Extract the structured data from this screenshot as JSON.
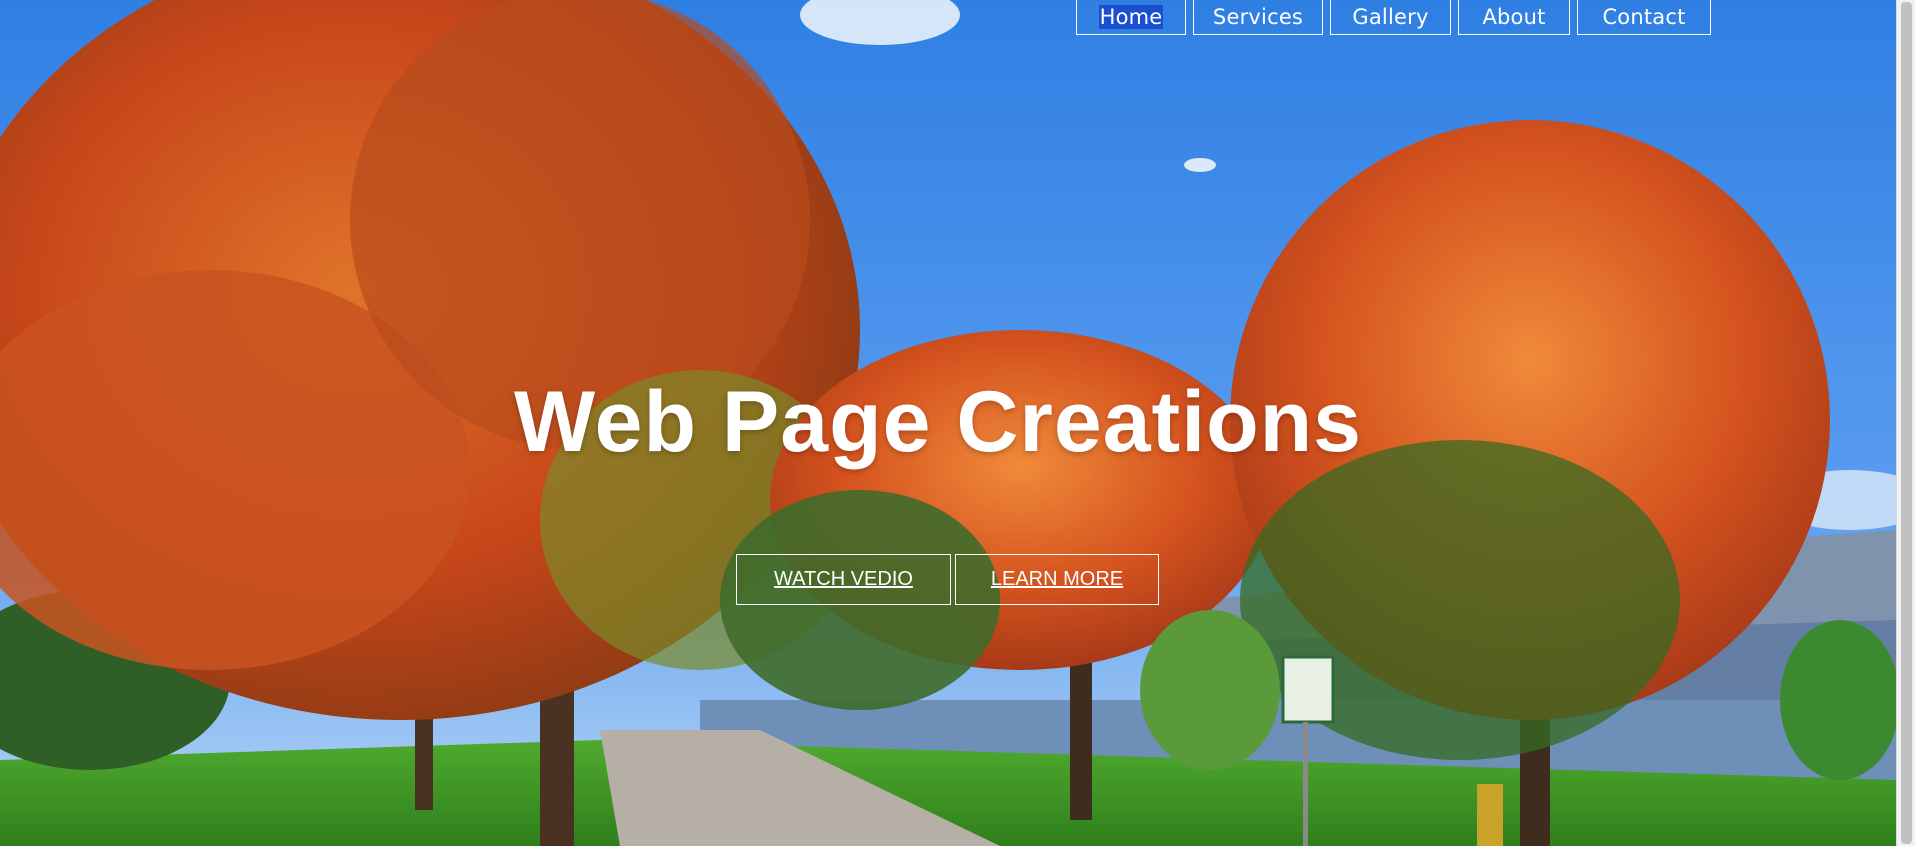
{
  "nav": {
    "items": [
      {
        "label": "Home"
      },
      {
        "label": "Services"
      },
      {
        "label": "Gallery"
      },
      {
        "label": "About"
      },
      {
        "label": "Contact"
      }
    ]
  },
  "hero": {
    "title": "Web Page Creations",
    "buttons": {
      "watch_label": "WATCH VEDIO",
      "learn_label": "LEARN MORE"
    }
  },
  "colors": {
    "sky": "#3f8be6",
    "foliage_orange": "#d9561c",
    "grass": "#3b9a2c",
    "nav_selected": "#1a4fd1",
    "text": "#ffffff"
  }
}
